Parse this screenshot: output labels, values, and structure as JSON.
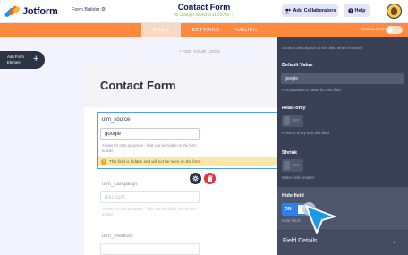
{
  "header": {
    "logo_text": "Jotform",
    "form_builder": "Form Builder ⚙",
    "form_title": "Contact Form",
    "saved_note": "All changes saved at 11:03 AM ⓘ",
    "add_collaborators": "Add Collaborators",
    "help": "Help"
  },
  "nav": {
    "tabs": [
      {
        "label": "BUILD",
        "active": true
      },
      {
        "label": "SETTINGS",
        "active": false
      },
      {
        "label": "PUBLISH",
        "active": false
      }
    ],
    "preview_form": "Preview Form",
    "accent": "#ff8a3d"
  },
  "left": {
    "add_element": "Add Form Element",
    "add_logo": "+ ADD YOUR LOGO"
  },
  "form": {
    "title": "Contact Form",
    "fields": [
      {
        "label": "utm_source",
        "value": "google",
        "help": "Allows for data purposes - field can be hidden in the form builder",
        "selected": true
      },
      {
        "label": "utm_campaign",
        "value": "discount",
        "help": "Allows for data purposes - field can be hidden in the form builder",
        "selected": false
      },
      {
        "label": "utm_medium",
        "value": "",
        "help": "",
        "selected": false
      }
    ],
    "hidden_warning": "This field is hidden and will not be seen on the form."
  },
  "panel": {
    "top_sub": "Show a description of this field when hovered",
    "default_value_label": "Default Value",
    "default_value": "google",
    "default_value_sub": "Pre-populate a value for this field",
    "readonly_label": "Read-only",
    "readonly_toggle": "OFF",
    "readonly_sub": "Prevent entry into this field",
    "shrink_label": "Shrink",
    "shrink_toggle": "OFF",
    "shrink_sub": "Make field smaller",
    "hide_label": "Hide field",
    "hide_toggle": "ON",
    "hide_sub": "Hide fields",
    "field_details": "Field Details"
  }
}
